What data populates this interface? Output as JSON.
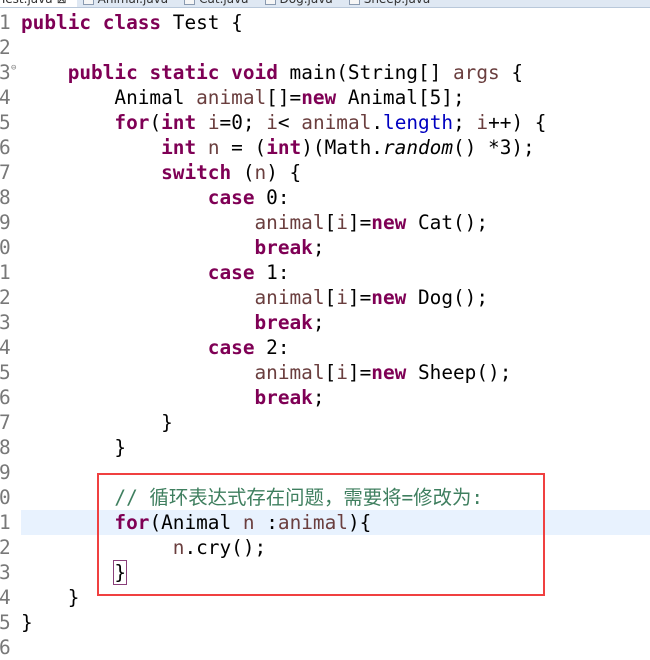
{
  "tabs": [
    {
      "label": "Test.java",
      "active": true,
      "close": "⊠"
    },
    {
      "label": "Animal.java"
    },
    {
      "label": "Cat.java"
    },
    {
      "label": "Dog.java"
    },
    {
      "label": "Sheep.java"
    }
  ],
  "colors": {
    "keyword": "#7f0055",
    "variable": "#6a3e3e",
    "field": "#0000c0",
    "comment": "#3f7f5f",
    "highlight": "#e8f2fe",
    "annotation_box": "#f04040"
  },
  "current_line": "1",
  "lines": [
    {
      "n": "1",
      "segs": [
        [
          "kw",
          "public"
        ],
        [
          "",
          ""
        ],
        [
          "",
          " "
        ],
        [
          "kw",
          "class"
        ],
        [
          "",
          " Test {"
        ]
      ]
    },
    {
      "n": "2",
      "segs": []
    },
    {
      "n": "3",
      "fold": "⊖",
      "segs": [
        [
          "",
          "    "
        ],
        [
          "kw",
          "public"
        ],
        [
          "",
          " "
        ],
        [
          "kw",
          "static"
        ],
        [
          "",
          " "
        ],
        [
          "kw",
          "void"
        ],
        [
          "",
          " main(String[] "
        ],
        [
          "var",
          "args"
        ],
        [
          "",
          " {"
        ]
      ]
    },
    {
      "n": "4",
      "segs": [
        [
          "",
          "        Animal "
        ],
        [
          "var",
          "animal"
        ],
        [
          "",
          "[]="
        ],
        [
          "kw",
          "new"
        ],
        [
          "",
          " Animal[5];"
        ]
      ]
    },
    {
      "n": "5",
      "segs": [
        [
          "",
          "        "
        ],
        [
          "kw",
          "for"
        ],
        [
          "",
          "("
        ],
        [
          "kw",
          "int"
        ],
        [
          "",
          " "
        ],
        [
          "var",
          "i"
        ],
        [
          "",
          "=0; "
        ],
        [
          "var",
          "i"
        ],
        [
          "",
          "< "
        ],
        [
          "var",
          "animal"
        ],
        [
          "",
          "."
        ],
        [
          "fld",
          "length"
        ],
        [
          "",
          "; "
        ],
        [
          "var",
          "i"
        ],
        [
          "",
          "++) {"
        ]
      ]
    },
    {
      "n": "6",
      "segs": [
        [
          "",
          "            "
        ],
        [
          "kw",
          "int"
        ],
        [
          "",
          " "
        ],
        [
          "var",
          "n"
        ],
        [
          "",
          " = ("
        ],
        [
          "kw",
          "int"
        ],
        [
          "",
          ")(Math."
        ],
        [
          "it",
          "random"
        ],
        [
          "",
          "() *3);"
        ]
      ]
    },
    {
      "n": "7",
      "segs": [
        [
          "",
          "            "
        ],
        [
          "kw",
          "switch"
        ],
        [
          "",
          " ("
        ],
        [
          "var",
          "n"
        ],
        [
          "",
          ") {"
        ]
      ]
    },
    {
      "n": "8",
      "segs": [
        [
          "",
          "                "
        ],
        [
          "kw",
          "case"
        ],
        [
          "",
          " 0:"
        ]
      ]
    },
    {
      "n": "9",
      "segs": [
        [
          "",
          "                    "
        ],
        [
          "var",
          "animal"
        ],
        [
          "",
          "["
        ],
        [
          "var",
          "i"
        ],
        [
          "",
          "]="
        ],
        [
          "kw",
          "new"
        ],
        [
          "",
          " Cat();"
        ]
      ]
    },
    {
      "n": "0",
      "segs": [
        [
          "",
          "                    "
        ],
        [
          "kw",
          "break"
        ],
        [
          "",
          ";"
        ]
      ]
    },
    {
      "n": "1",
      "segs": [
        [
          "",
          "                "
        ],
        [
          "kw",
          "case"
        ],
        [
          "",
          " 1:"
        ]
      ]
    },
    {
      "n": "2",
      "segs": [
        [
          "",
          "                    "
        ],
        [
          "var",
          "animal"
        ],
        [
          "",
          "["
        ],
        [
          "var",
          "i"
        ],
        [
          "",
          "]="
        ],
        [
          "kw",
          "new"
        ],
        [
          "",
          " Dog();"
        ]
      ]
    },
    {
      "n": "3",
      "segs": [
        [
          "",
          "                    "
        ],
        [
          "kw",
          "break"
        ],
        [
          "",
          ";"
        ]
      ]
    },
    {
      "n": "4",
      "segs": [
        [
          "",
          "                "
        ],
        [
          "kw",
          "case"
        ],
        [
          "",
          " 2:"
        ]
      ]
    },
    {
      "n": "5",
      "segs": [
        [
          "",
          "                    "
        ],
        [
          "var",
          "animal"
        ],
        [
          "",
          "["
        ],
        [
          "var",
          "i"
        ],
        [
          "",
          "]="
        ],
        [
          "kw",
          "new"
        ],
        [
          "",
          " Sheep();"
        ]
      ]
    },
    {
      "n": "6",
      "segs": [
        [
          "",
          "                    "
        ],
        [
          "kw",
          "break"
        ],
        [
          "",
          ";"
        ]
      ]
    },
    {
      "n": "7",
      "segs": [
        [
          "",
          "            }"
        ]
      ]
    },
    {
      "n": "8",
      "segs": [
        [
          "",
          "        }"
        ]
      ]
    },
    {
      "n": "9",
      "segs": []
    },
    {
      "n": "0",
      "segs": [
        [
          "",
          "        "
        ],
        [
          "cm",
          "// 循环表达式存在问题，需要将=修改为:"
        ]
      ]
    },
    {
      "n": "1",
      "hl": true,
      "segs": [
        [
          "",
          "        "
        ],
        [
          "kw",
          "for"
        ],
        [
          "",
          "(Animal "
        ],
        [
          "var",
          "n"
        ],
        [
          "",
          " :"
        ],
        [
          "var",
          "animal"
        ],
        [
          "",
          "){"
        ]
      ]
    },
    {
      "n": "2",
      "segs": [
        [
          "",
          "             "
        ],
        [
          "var",
          "n"
        ],
        [
          "",
          ".cry();"
        ]
      ]
    },
    {
      "n": "3",
      "segs": [
        [
          "",
          "        "
        ],
        [
          "br",
          "}"
        ]
      ]
    },
    {
      "n": "4",
      "segs": [
        [
          "",
          "    }"
        ]
      ]
    },
    {
      "n": "5",
      "segs": [
        [
          "",
          "}"
        ]
      ]
    },
    {
      "n": "6",
      "segs": []
    }
  ]
}
